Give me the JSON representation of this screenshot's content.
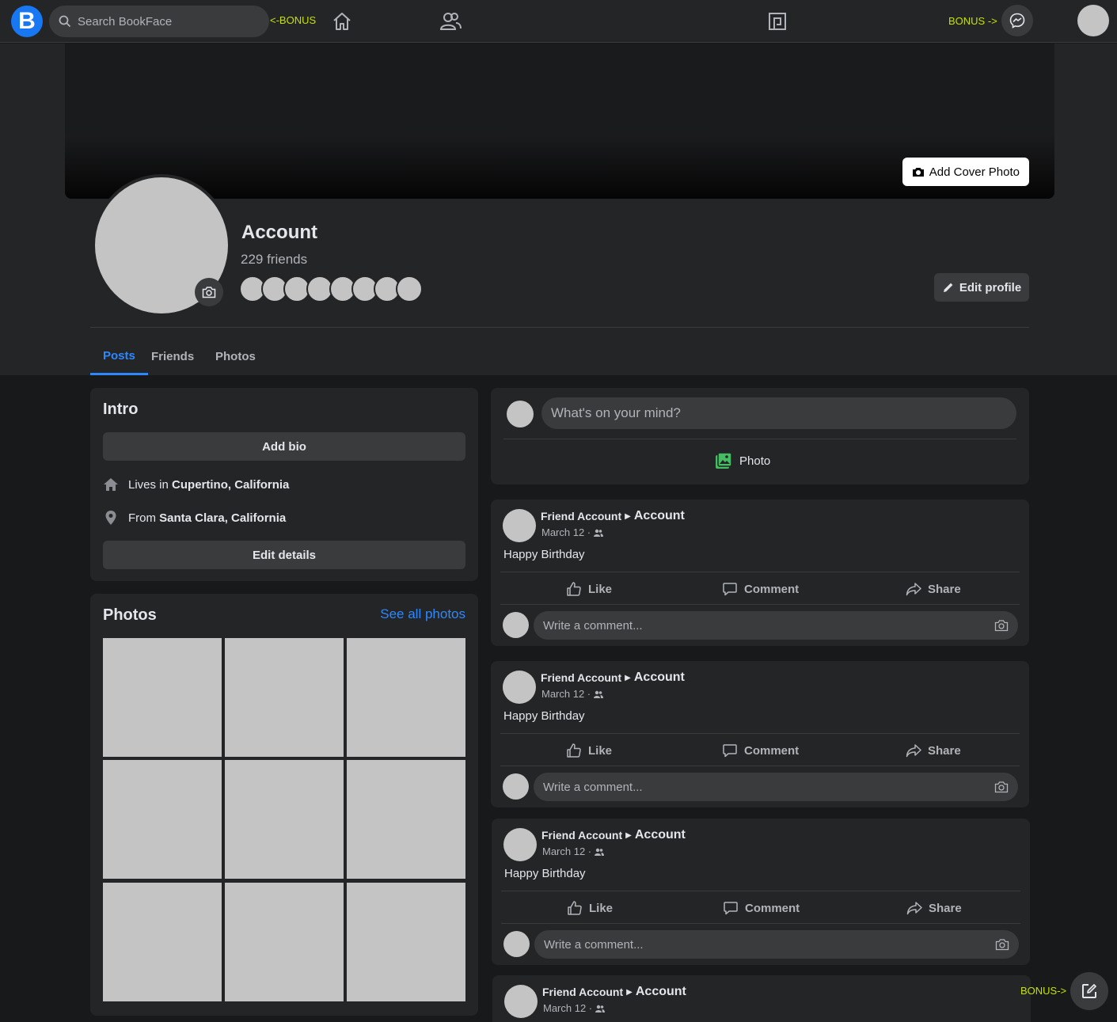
{
  "topbar": {
    "logo": "B",
    "search_placeholder": "Search BookFace",
    "bonus_left": "<-BONUS",
    "bonus_right": "BONUS ->"
  },
  "profile": {
    "add_cover_label": "Add Cover Photo",
    "name": "Account",
    "friends_count": "229 friends",
    "edit_profile_label": "Edit profile",
    "tabs": [
      "Posts",
      "Friends",
      "Photos"
    ],
    "active_tab": "Posts"
  },
  "intro": {
    "title": "Intro",
    "add_bio_label": "Add bio",
    "lives_prefix": "Lives in",
    "lives_place": "Cupertino, California",
    "from_prefix": "From",
    "from_place": "Santa Clara, California",
    "edit_details_label": "Edit details"
  },
  "photos": {
    "title": "Photos",
    "see_all_label": "See all photos"
  },
  "composer": {
    "placeholder": "What's on your mind?",
    "photo_label": "Photo"
  },
  "posts": [
    {
      "author": "Friend Account",
      "target": "Account",
      "date": "March 12 ·",
      "text": "Happy Birthday",
      "like": "Like",
      "comment": "Comment",
      "share": "Share",
      "comment_placeholder": "Write a comment..."
    },
    {
      "author": "Friend Account",
      "target": "Account",
      "date": "March 12 ·",
      "text": "Happy Birthday",
      "like": "Like",
      "comment": "Comment",
      "share": "Share",
      "comment_placeholder": "Write a comment..."
    },
    {
      "author": "Friend Account",
      "target": "Account",
      "date": "March 12 ·",
      "text": "Happy Birthday",
      "like": "Like",
      "comment": "Comment",
      "share": "Share",
      "comment_placeholder": "Write a comment..."
    },
    {
      "author": "Friend Account",
      "target": "Account",
      "date": "March 12 ·"
    }
  ],
  "fab": {
    "bonus_label": "BONUS->"
  },
  "icons": [
    "search-icon",
    "home-icon",
    "friends-icon",
    "gaming-icon",
    "messenger-icon",
    "camera-icon",
    "pencil-icon",
    "house-icon",
    "location-pin-icon",
    "photo-icon",
    "like-icon",
    "comment-icon",
    "share-icon",
    "group-audience-icon",
    "edit-compose-icon"
  ],
  "colors": {
    "accent": "#2d88ff",
    "brand": "#1877f2",
    "bonus": "#c6e000",
    "photo_green": "#45bd62"
  }
}
